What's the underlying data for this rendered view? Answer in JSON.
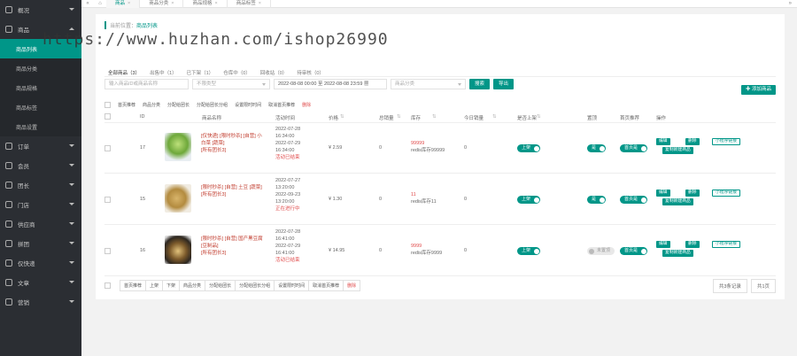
{
  "sidebar": {
    "items": [
      {
        "label": "概况",
        "open": false
      },
      {
        "label": "商品",
        "open": true,
        "children": [
          "商品列表",
          "商品分类",
          "商品规格",
          "商品标签",
          "商品设置"
        ]
      },
      {
        "label": "订单",
        "open": false
      },
      {
        "label": "会员",
        "open": false
      },
      {
        "label": "团长",
        "open": false
      },
      {
        "label": "门店",
        "open": false
      },
      {
        "label": "供应商",
        "open": false
      },
      {
        "label": "拼团",
        "open": false
      },
      {
        "label": "仅快递",
        "open": false
      },
      {
        "label": "文章",
        "open": false
      },
      {
        "label": "营销",
        "open": false
      }
    ]
  },
  "topbar": {
    "tabs": [
      "商品",
      "商品分类",
      "商品规格",
      "商品标签"
    ],
    "active_tab": "商品"
  },
  "breadcrumb": {
    "prefix": "当前位置：",
    "current": "商品列表"
  },
  "watermark": "https://www.huzhan.com/ishop26990",
  "status_tabs": [
    "全部商品（3）",
    "出售中（1）",
    "已下架（1）",
    "仓库中（0）",
    "回收站（0）",
    "待审核（0）"
  ],
  "filters": {
    "keyword_placeholder": "输入商品ID或商品名称",
    "type_placeholder": "不限类型",
    "date_range": "2022-08-08 00:00 至 2022-08-08 23:59",
    "category_placeholder": "商品分类",
    "search_label": "搜索",
    "export_label": "导出"
  },
  "add_button": "添加商品",
  "bulk_actions": [
    "首页推荐",
    "商品分类",
    "分配给团长",
    "分配给团长分组",
    "设置限时时间",
    "取消首页推荐",
    "删除"
  ],
  "columns": [
    "ID",
    "商品名称",
    "活动时间",
    "价格",
    "总销量",
    "库存",
    "今日销量",
    "是否上架",
    "置顶",
    "首页推荐",
    "操作"
  ],
  "rows": [
    {
      "id": "17",
      "name": "[仅快递] [限时秒杀] [自营] 小白菜 [蔬菜]",
      "group": "[所有团长3]",
      "time": [
        "2022-07-28",
        "16:34:00",
        "2022-07-29",
        "16:34:00"
      ],
      "time_status": "活动已结束",
      "price": "¥ 2.59",
      "sales": "0",
      "stock": "99999",
      "stock_note": "redis库存99999",
      "today_sales": "0",
      "on_sale": "上架",
      "pin": "是",
      "recommend": "首页是",
      "image": "vegetable"
    },
    {
      "id": "15",
      "name": "[限时秒杀] [自营] 土豆 [蔬菜]",
      "group": "[所有团长3]",
      "time": [
        "2022-07-27",
        "13:20:00",
        "2022-09-23",
        "13:20:00"
      ],
      "time_status": "正在进行中",
      "price": "¥ 1.30",
      "sales": "0",
      "stock": "11",
      "stock_note": "redis库存11",
      "today_sales": "0",
      "on_sale": "上架",
      "pin": "是",
      "recommend": "首页是",
      "image": "potato"
    },
    {
      "id": "16",
      "name": "[限时秒杀] [自营] 国产黑豆腐 [豆制品]",
      "group": "[所有团长3]",
      "time": [
        "2022-07-28",
        "16:41:00",
        "2022-07-29",
        "16:41:00"
      ],
      "time_status": "活动已结束",
      "price": "¥ 14.95",
      "sales": "0",
      "stock": "9999",
      "stock_note": "redis库存9999",
      "today_sales": "0",
      "on_sale": "上架",
      "pin": "未置顶",
      "recommend": "首页是",
      "image": "tofu"
    }
  ],
  "row_actions": {
    "edit": "编辑",
    "delete": "删除",
    "mini_link": "小程序链接",
    "copy": "复制新建商品"
  },
  "footer_actions": [
    "首页推荐",
    "上架",
    "下架",
    "商品分类",
    "分配给团长",
    "分配给团长分组",
    "设置限时时间",
    "取消首页推荐",
    "删除"
  ],
  "pager": {
    "total": "共3条记录",
    "pages": "共1页"
  },
  "colors": {
    "accent": "#009688",
    "danger": "#e04b4b",
    "sidebar": "#2b2e33"
  }
}
